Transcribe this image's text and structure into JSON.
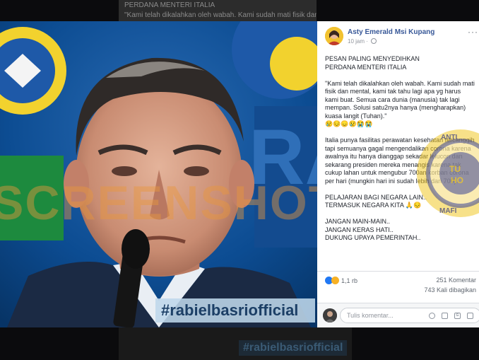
{
  "background_post": {
    "line1": "PERDANA MENTERI ITALIA",
    "line2": "\"Kami telah dikalahkan oleh wabah. Kami sudah mati fisik dan mental. kami"
  },
  "photo": {
    "watermark_text": "SCREENSHOT BY",
    "hashtag": "#rabielbasriofficial",
    "colors": {
      "stage_background": "#0d4a8a",
      "watermark": "#e8963c"
    }
  },
  "background_hashtag": "#rabielbasriofficial",
  "post": {
    "author": "Asty Emerald Msi Kupang",
    "time": "10 jam",
    "paragraphs": [
      "PESAN PALING MENYEDIHKAN\nPERDANA MENTERI ITALIA",
      "\"Kami telah dikalahkan oleh wabah. Kami sudah mati fisik dan mental, kami tak tahu lagi apa yg harus kami buat. Semua cara dunia (manusia) tak lagi mempan. Solusi satu2nya hanya (mengharapkan) kuasa langit (Tuhan).\"\n😢😔😞😢😭😭",
      "Italia punya fasilitas perawatan kesehatan tercanggih tapi semuanya gagal mengendalikan corona karena awalnya itu hanya dianggap sekadar lelucon dan sekarang presiden mereka menangis karena tak cukup lahan untuk mengubur 700an korban corona per hari (mungkin hari ini sudah lebih dari 700).",
      "PELAJARAN BAGI NEGARA LAIN..\nTERMASUK NEGARA KITA 🙏😔",
      "JANGAN MAIN-MAIN..\nJANGAN KERAS HATI..\nDUKUNG UPAYA PEMERINTAH.."
    ],
    "reaction_count": "1,1 rb",
    "comments": "251 Komentar",
    "shares": "743 Kali dibagikan",
    "comment_placeholder": "Tulis komentar...",
    "colors": {
      "author": "#385898",
      "like": "#2078f4"
    }
  },
  "stamp_letters": [
    "MAFI",
    "HO",
    "ANTI",
    "TU"
  ]
}
